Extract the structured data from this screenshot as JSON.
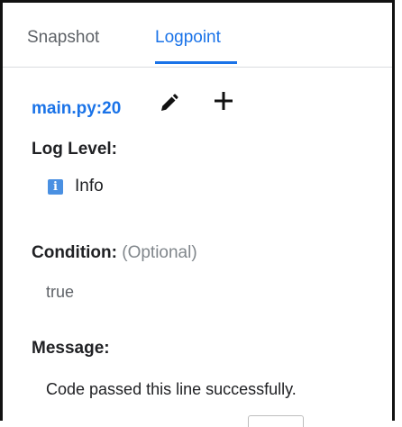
{
  "tabs": [
    {
      "label": "Snapshot"
    },
    {
      "label": "Logpoint"
    }
  ],
  "active_tab": "Logpoint",
  "location": {
    "label": "main.py:20",
    "edit_icon": "pencil-icon",
    "add_icon": "plus-icon"
  },
  "log_level": {
    "label": "Log Level:",
    "badge_glyph": "i",
    "value": "Info"
  },
  "condition": {
    "label": "Condition:",
    "optional": "(Optional)",
    "value": "true"
  },
  "message": {
    "label": "Message:",
    "value": "Code passed this line successfully."
  },
  "colors": {
    "accent": "#1a73e8",
    "info_badge": "#4a90e2"
  }
}
